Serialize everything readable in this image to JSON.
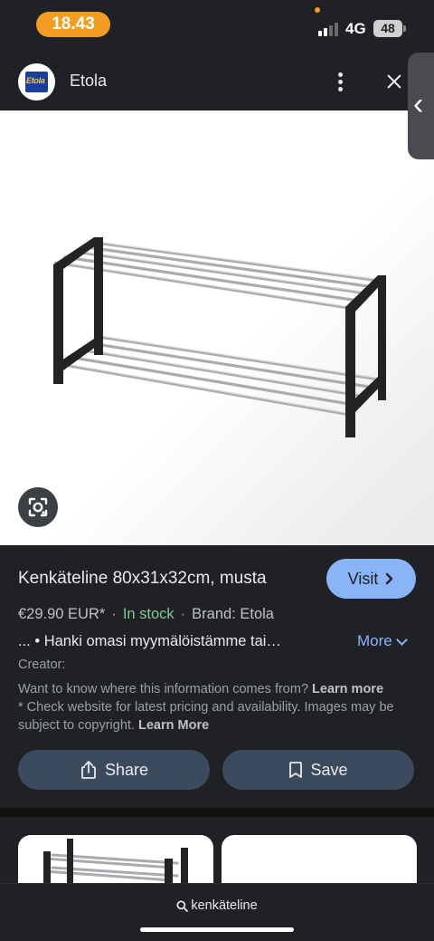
{
  "status": {
    "time": "18.43",
    "network": "4G",
    "battery": "48"
  },
  "header": {
    "site_name": "Etola",
    "logo_text": "Etola"
  },
  "product": {
    "title": "Kenkäteline 80x31x32cm, musta",
    "visit_label": "Visit",
    "price": "€29.90 EUR*",
    "stock": "In stock",
    "brand": "Brand: Etola",
    "description": "... • Hanki omasi myymälöistämme tai…",
    "more_label": "More",
    "creator_label": "Creator:",
    "info_question": "Want to know where this information comes from?",
    "learn_more_1": "Learn more",
    "disclaimer": "* Check website for latest pricing and availability. Images may be subject to copyright.",
    "learn_more_2": "Learn More",
    "share_label": "Share",
    "save_label": "Save"
  },
  "bottom": {
    "query": "kenkäteline"
  },
  "colors": {
    "accent": "#8ab4f8",
    "in_stock": "#81c995",
    "time_pill": "#f29d22",
    "action_button": "#3c4a5e"
  },
  "icons": [
    "lens-icon",
    "share-icon",
    "bookmark-icon",
    "search-icon",
    "more-vert-icon",
    "close-icon",
    "chevron-left-icon"
  ]
}
